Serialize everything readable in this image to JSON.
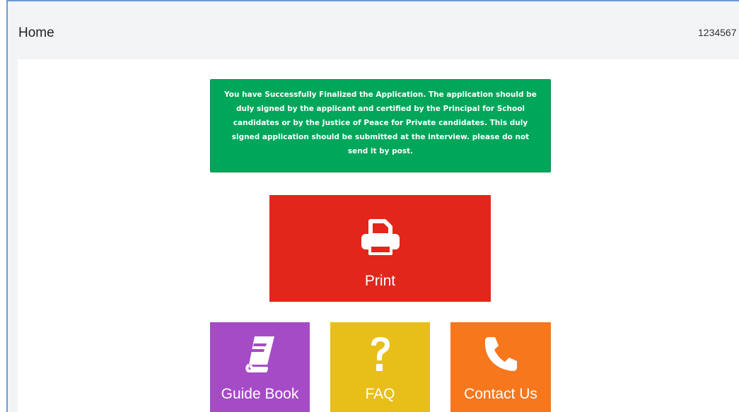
{
  "header": {
    "title": "Home",
    "user_id": "1234567"
  },
  "alert": {
    "message": "You have Successfully Finalized the Application. The application should be duly signed by the applicant and certified by the Principal for School candidates or by the Justice of Peace for Private candidates. This duly signed application should be submitted at the interview. please do not send it by post.",
    "color": "#00a65a"
  },
  "tiles": {
    "print": {
      "label": "Print",
      "icon": "printer-icon",
      "color": "#e3261b"
    },
    "guide_book": {
      "label": "Guide Book",
      "icon": "book-icon",
      "color": "#a54bc6"
    },
    "faq": {
      "label": "FAQ",
      "icon": "question-icon",
      "color": "#e8be19"
    },
    "contact_us": {
      "label": "Contact Us",
      "icon": "phone-icon",
      "color": "#f7771d"
    }
  }
}
